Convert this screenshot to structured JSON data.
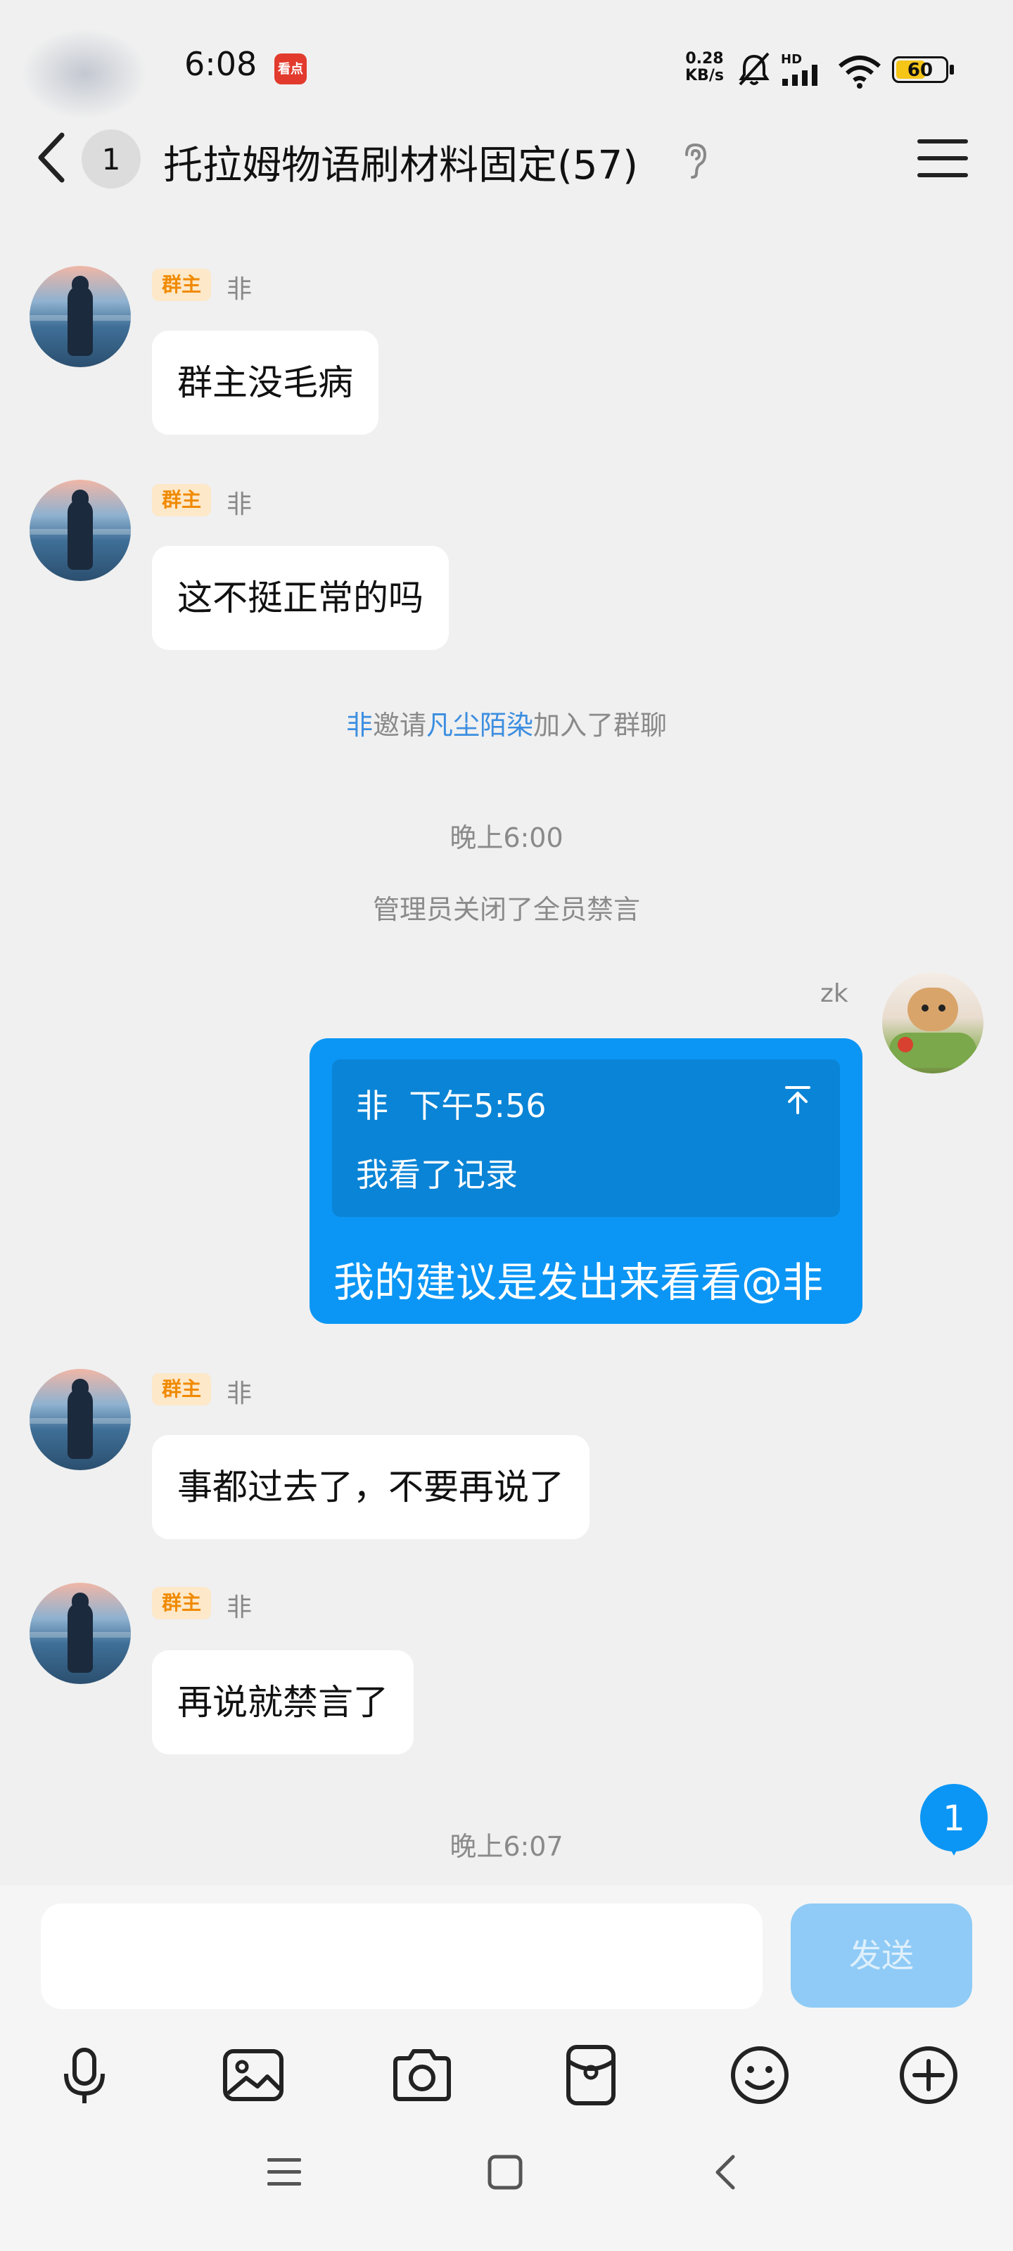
{
  "status_bar": {
    "time": "6:08",
    "app_badge_text": "看点",
    "net_speed_value": "0.28",
    "net_speed_unit": "KB/s",
    "signal_label": "HD",
    "battery": "60",
    "battery_level": 0.6
  },
  "header": {
    "unread_count": "1",
    "title": "托拉姆物语刷材料固定(57)"
  },
  "messages": [
    {
      "tag": "群主",
      "sender": "非",
      "text": "群主没毛病"
    },
    {
      "tag": "群主",
      "sender": "非",
      "text": "这不挺正常的吗"
    }
  ],
  "system": {
    "invite": {
      "inviter": "非",
      "verb": "邀请",
      "invitee": "凡尘陌染",
      "suffix": "加入了群聊"
    },
    "time1": "晚上6:00",
    "mute_off": "管理员关闭了全员禁言",
    "time2": "晚上6:07"
  },
  "my_message": {
    "sender": "zk",
    "quote_sender": "非",
    "quote_time": "下午5:56",
    "quote_text": "我看了记录",
    "text": "我的建议是发出来看看@非"
  },
  "messages2": [
    {
      "tag": "群主",
      "sender": "非",
      "text": "事都过去了，不要再说了"
    },
    {
      "tag": "群主",
      "sender": "非",
      "text": "再说就禁言了"
    }
  ],
  "floating_badge": "1",
  "input": {
    "placeholder": "",
    "send_label": "发送"
  },
  "toolbar_icons": [
    "mic-icon",
    "image-icon",
    "camera-icon",
    "red-packet-icon",
    "emoji-icon",
    "plus-icon"
  ],
  "colors": {
    "accent": "#0b96f5",
    "tag_bg": "#fde8c9",
    "tag_text": "#f08a00",
    "link": "#3c8ee0"
  }
}
